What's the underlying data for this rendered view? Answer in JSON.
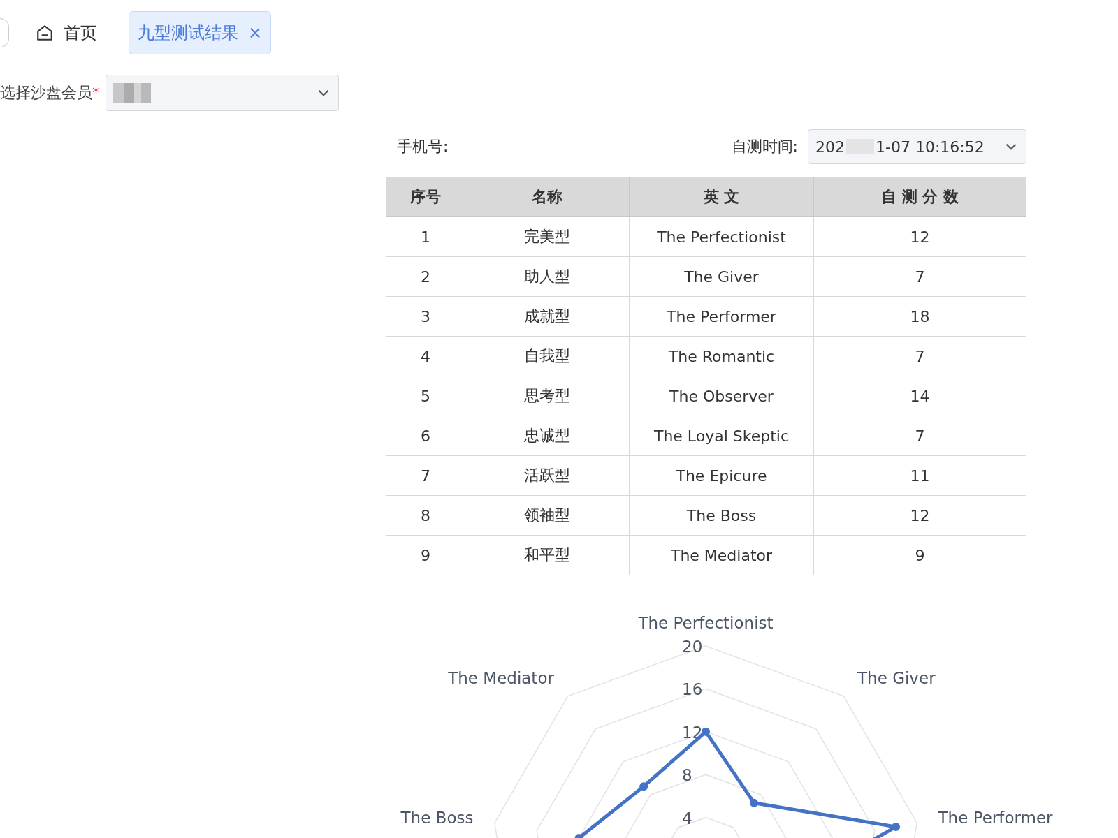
{
  "tabs": [
    {
      "kind": "home",
      "label": "首页",
      "selected": false
    },
    {
      "kind": "page",
      "label": "九型测试结果",
      "close": "×",
      "selected": true
    }
  ],
  "member_select": {
    "label": "选择沙盘会员",
    "required_mark": "*"
  },
  "phone": {
    "label": "手机号:"
  },
  "test_time": {
    "label": "自测时间:",
    "value_start": "202",
    "value_end": "1-07 10:16:52"
  },
  "table": {
    "columns": [
      "序号",
      "名称",
      "英 文",
      "自 测 分 数"
    ],
    "rows": [
      [
        "1",
        "完美型",
        "The Perfectionist",
        "12"
      ],
      [
        "2",
        "助人型",
        "The Giver",
        "7"
      ],
      [
        "3",
        "成就型",
        "The Performer",
        "18"
      ],
      [
        "4",
        "自我型",
        "The Romantic",
        "7"
      ],
      [
        "5",
        "思考型",
        "The Observer",
        "14"
      ],
      [
        "6",
        "忠诚型",
        "The Loyal Skeptic",
        "7"
      ],
      [
        "7",
        "活跃型",
        "The Epicure",
        "11"
      ],
      [
        "8",
        "领袖型",
        "The Boss",
        "12"
      ],
      [
        "9",
        "和平型",
        "The Mediator",
        "9"
      ]
    ]
  },
  "radar": {
    "axis_labels": [
      {
        "kind": "top",
        "text": "The Perfectionist"
      },
      {
        "kind": "upperleft",
        "text": "The Mediator"
      },
      {
        "kind": "upperright",
        "text": "The Giver"
      },
      {
        "kind": "left",
        "text": "The Boss"
      },
      {
        "kind": "right",
        "text": "The Performer"
      }
    ],
    "ticks": [
      "20",
      "16",
      "12",
      "8",
      "4"
    ]
  }
}
